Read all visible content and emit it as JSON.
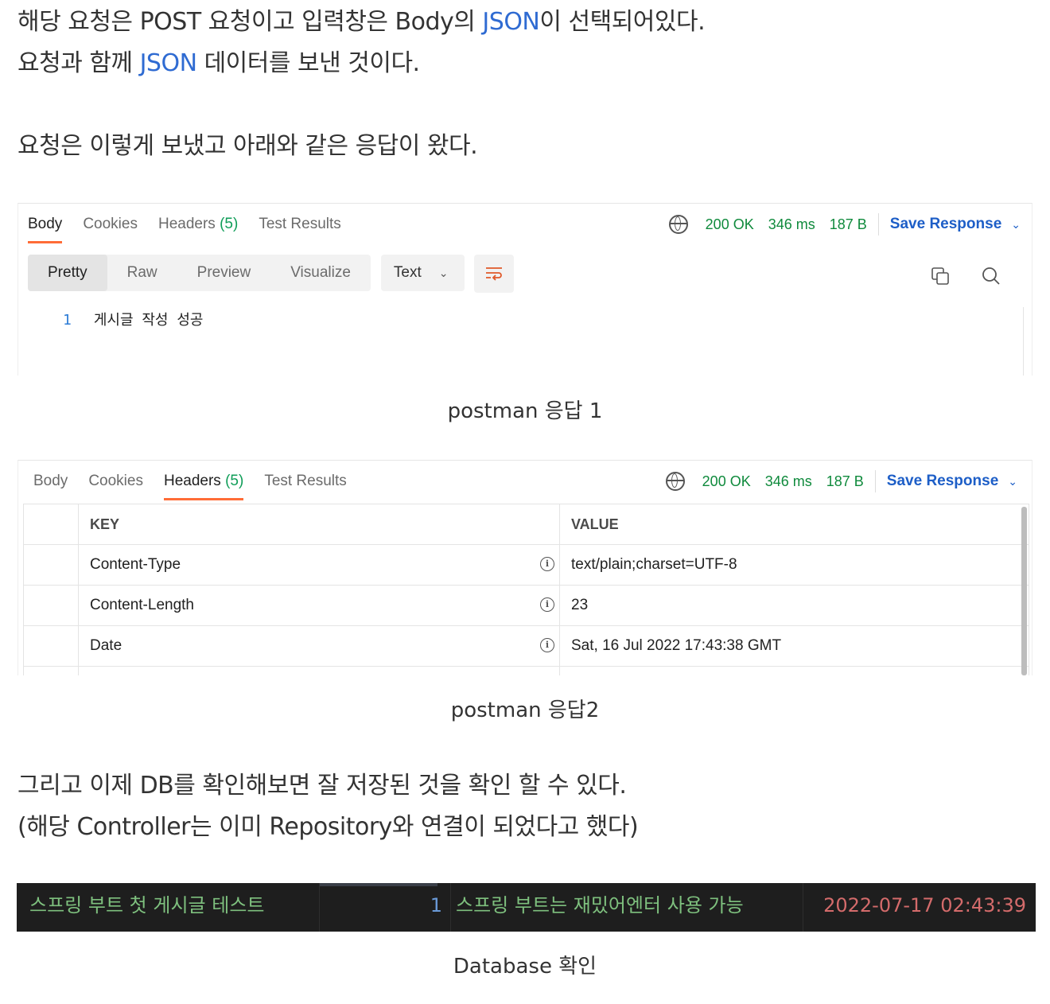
{
  "intro": {
    "line1_a": "해당 요청은 POST 요청이고 입력창은 Body의 ",
    "line1_hl": "JSON",
    "line1_b": "이 선택되어있다.",
    "line2_a": "요청과 함께 ",
    "line2_hl": "JSON",
    "line2_b": " 데이터를 보낸 것이다.",
    "line3": "요청은 이렇게 보냈고 아래와 같은 응답이 왔다."
  },
  "response_tabs": {
    "body": "Body",
    "cookies": "Cookies",
    "headers": "Headers",
    "headers_count": "(5)",
    "tests": "Test Results"
  },
  "status": {
    "code": "200 OK",
    "time": "346 ms",
    "size": "187 B",
    "save": "Save Response"
  },
  "format_tabs": [
    "Pretty",
    "Raw",
    "Preview",
    "Visualize"
  ],
  "format_select": "Text",
  "body_lines": [
    {
      "num": "1",
      "text": "게시글 작성 성공"
    }
  ],
  "caption1": "postman 응답 1",
  "headers_table": {
    "key_header": "KEY",
    "value_header": "VALUE",
    "rows": [
      {
        "key": "Content-Type",
        "value": "text/plain;charset=UTF-8"
      },
      {
        "key": "Content-Length",
        "value": "23"
      },
      {
        "key": "Date",
        "value": "Sat, 16 Jul 2022 17:43:38 GMT"
      }
    ]
  },
  "caption2": "postman 응답2",
  "outro": {
    "line1": "그리고 이제 DB를 확인해보면 잘 저장된 것을 확인 할 수 있다.",
    "line2": "(해당 Controller는 이미 Repository와 연결이 되었다고 했다)"
  },
  "db_row": {
    "title": "스프링 부트 첫 게시글 테스트",
    "id": "1",
    "content": "스프링 부트는 재밌어엔터 사용 가능",
    "date": "2022-07-17 02:43:39"
  },
  "caption3": "Database 확인",
  "colors": {
    "accent_orange": "#ff6c37",
    "status_green": "#0f8a3c",
    "link_blue": "#1d5ec7"
  }
}
